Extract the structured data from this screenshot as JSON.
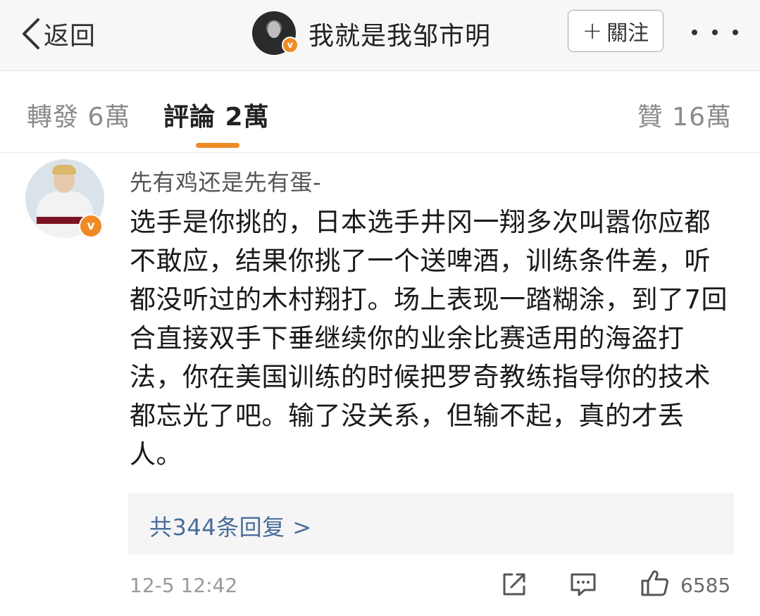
{
  "header": {
    "back_label": "返回",
    "title": "我就是我邹市明",
    "follow_label": "關注"
  },
  "tabs": [
    {
      "label": "轉發 6萬"
    },
    {
      "label": "評論 2萬"
    },
    {
      "label": "贊 16萬"
    }
  ],
  "comment": {
    "username": "先有鸡还是先有蛋-",
    "text": "选手是你挑的，日本选手井冈一翔多次叫嚣你应都不敢应，结果你挑了一个送啤酒，训练条件差，听都没听过的木村翔打。场上表现一踏糊涂，到了7回合直接双手下垂继续你的业余比赛适用的海盗打法，你在美国训练的时候把罗奇教练指导你的技术都忘光了吧。输了没关系，但输不起，真的才丢人。",
    "replies_label": "共344条回复 >",
    "time": "12-5 12:42",
    "like_count": "6585"
  },
  "colors": {
    "accent": "#f08a24",
    "link": "#4a6d9a",
    "header_bg": "#f7f7f7"
  },
  "icons": [
    "chevron-left-icon",
    "plus-icon",
    "more-dots-icon",
    "verified-badge-icon",
    "share-icon",
    "comment-icon",
    "thumbs-up-icon"
  ]
}
